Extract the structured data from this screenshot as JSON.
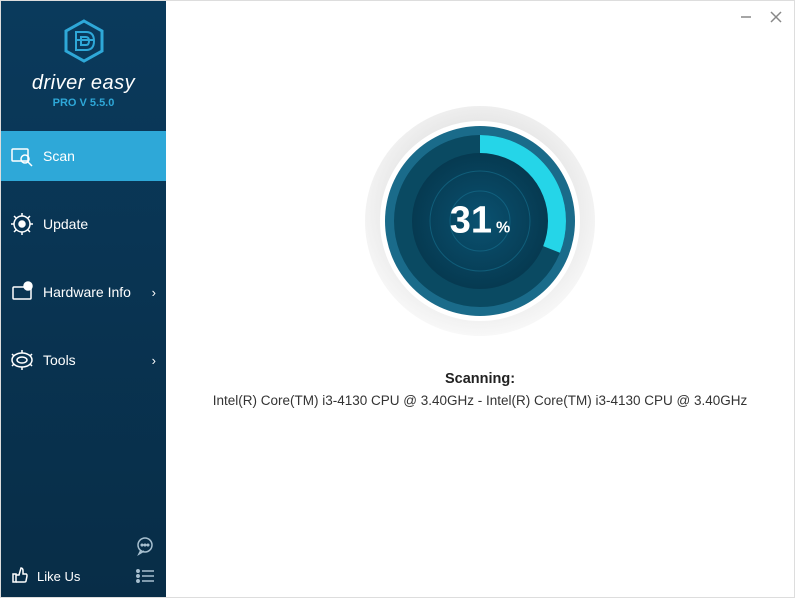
{
  "brand": {
    "name": "driver easy",
    "version": "PRO V 5.5.0"
  },
  "nav": {
    "scan": "Scan",
    "update": "Update",
    "hardware": "Hardware Info",
    "tools": "Tools"
  },
  "footer": {
    "like_us": "Like Us"
  },
  "progress": {
    "value": "31",
    "unit": "%"
  },
  "status": {
    "title": "Scanning:",
    "detail": "Intel(R) Core(TM) i3-4130 CPU @ 3.40GHz - Intel(R) Core(TM) i3-4130 CPU @ 3.40GHz"
  }
}
